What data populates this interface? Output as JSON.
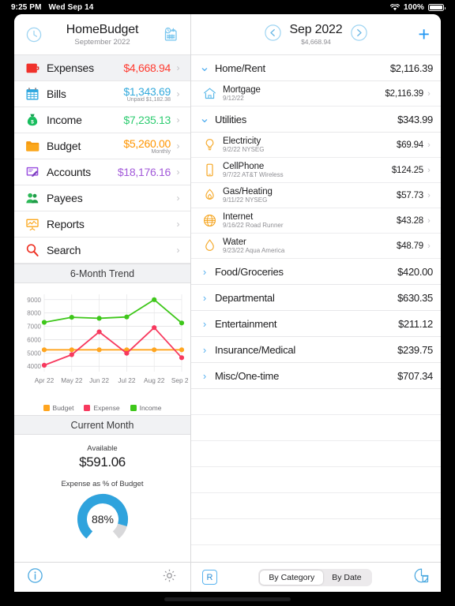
{
  "status_bar": {
    "time": "9:25 PM",
    "date": "Wed Sep 14",
    "battery": "100%",
    "wifi_icon": "wifi-icon"
  },
  "left_header": {
    "title": "HomeBudget",
    "subtitle": "September 2022",
    "history_icon": "clock-history-icon",
    "schedule_icon": "calendar-clock-icon"
  },
  "sidebar": {
    "items": [
      {
        "label": "Expenses",
        "value": "$4,668.94",
        "sub": "",
        "color": "#ff3b30",
        "icon": "wallet-icon",
        "selected": true
      },
      {
        "label": "Bills",
        "value": "$1,343.69",
        "sub": "Unpaid $1,182.38",
        "color": "#34aadc",
        "icon": "calendar-icon",
        "selected": false
      },
      {
        "label": "Income",
        "value": "$7,235.13",
        "sub": "",
        "color": "#2ecc71",
        "icon": "money-bag-icon",
        "selected": false
      },
      {
        "label": "Budget",
        "value": "$5,260.00",
        "sub": "Monthly",
        "color": "#ff9500",
        "icon": "folder-icon",
        "selected": false
      },
      {
        "label": "Accounts",
        "value": "$18,176.16",
        "sub": "",
        "color": "#a259d9",
        "icon": "register-icon",
        "selected": false
      },
      {
        "label": "Payees",
        "value": "",
        "sub": "",
        "color": "#1c1c1e",
        "icon": "people-icon",
        "selected": false
      },
      {
        "label": "Reports",
        "value": "",
        "sub": "",
        "color": "#1c1c1e",
        "icon": "chart-board-icon",
        "selected": false
      },
      {
        "label": "Search",
        "value": "",
        "sub": "",
        "color": "#1c1c1e",
        "icon": "magnifier-icon",
        "selected": false
      }
    ],
    "chevron": "›"
  },
  "trend_section": {
    "header": "6-Month Trend"
  },
  "chart_data": {
    "type": "line",
    "title": "6-Month Trend",
    "xlabel": "",
    "ylabel": "",
    "x": [
      "Apr 22",
      "May 22",
      "Jun 22",
      "Jul 22",
      "Aug 22",
      "Sep 22"
    ],
    "ylim": [
      3600,
      9400
    ],
    "yticks": [
      4000,
      5000,
      6000,
      7000,
      8000,
      9000
    ],
    "grid": true,
    "legend_position": "bottom",
    "series": [
      {
        "name": "Budget",
        "color": "#ffa51f",
        "values": [
          5240,
          5240,
          5240,
          5240,
          5240,
          5240
        ]
      },
      {
        "name": "Expense",
        "color": "#f7395e",
        "values": [
          4080,
          4870,
          6580,
          4980,
          6900,
          4650
        ]
      },
      {
        "name": "Income",
        "color": "#3ec71a",
        "values": [
          7300,
          7680,
          7600,
          7700,
          9000,
          7250
        ]
      }
    ]
  },
  "current_month": {
    "header": "Current Month",
    "available_label": "Available",
    "available_value": "$591.06",
    "gauge_label": "Expense as % of Budget",
    "gauge_value": "88%",
    "gauge_percent": 88,
    "gauge_color": "#2fa3dd",
    "gauge_track": "#d8d8da"
  },
  "left_toolbar": {
    "info_icon": "info-circle-icon",
    "settings_icon": "gear-icon"
  },
  "right_header": {
    "title": "Sep 2022",
    "subtitle": "$4,668.94",
    "prev_icon": "arrow-left-circle-icon",
    "next_icon": "arrow-right-circle-icon",
    "add_label": "+"
  },
  "expense_list": {
    "chevron_right": "›",
    "groups": [
      {
        "name": "Home/Rent",
        "amount": "$2,116.39",
        "expanded": true,
        "items": [
          {
            "name": "Mortgage",
            "sub": "9/12/22",
            "amount": "$2,116.39",
            "icon": "home-icon",
            "color": "#5bb8e8"
          }
        ]
      },
      {
        "name": "Utilities",
        "amount": "$343.99",
        "expanded": true,
        "items": [
          {
            "name": "Electricity",
            "sub": "9/2/22 NYSEG",
            "amount": "$69.94",
            "icon": "lightbulb-icon",
            "color": "#f5a623"
          },
          {
            "name": "CellPhone",
            "sub": "9/7/22 AT&T Wireless",
            "amount": "$124.25",
            "icon": "phone-icon",
            "color": "#f5a623"
          },
          {
            "name": "Gas/Heating",
            "sub": "9/11/22 NYSEG",
            "amount": "$57.73",
            "icon": "flame-icon",
            "color": "#f5a623"
          },
          {
            "name": "Internet",
            "sub": "9/16/22 Road Runner",
            "amount": "$43.28",
            "icon": "globe-icon",
            "color": "#f5a623"
          },
          {
            "name": "Water",
            "sub": "9/23/22 Aqua America",
            "amount": "$48.79",
            "icon": "water-drop-icon",
            "color": "#f5a623"
          }
        ]
      },
      {
        "name": "Food/Groceries",
        "amount": "$420.00",
        "expanded": false,
        "items": []
      },
      {
        "name": "Departmental",
        "amount": "$630.35",
        "expanded": false,
        "items": []
      },
      {
        "name": "Entertainment",
        "amount": "$211.12",
        "expanded": false,
        "items": []
      },
      {
        "name": "Insurance/Medical",
        "amount": "$239.75",
        "expanded": false,
        "items": []
      },
      {
        "name": "Misc/One-time",
        "amount": "$707.34",
        "expanded": false,
        "items": []
      }
    ],
    "empty_rows": 6
  },
  "right_toolbar": {
    "recurring_label": "R",
    "segments": [
      {
        "label": "By Category",
        "selected": true
      },
      {
        "label": "By Date",
        "selected": false
      }
    ],
    "pie_icon": "pie-chart-icon"
  }
}
